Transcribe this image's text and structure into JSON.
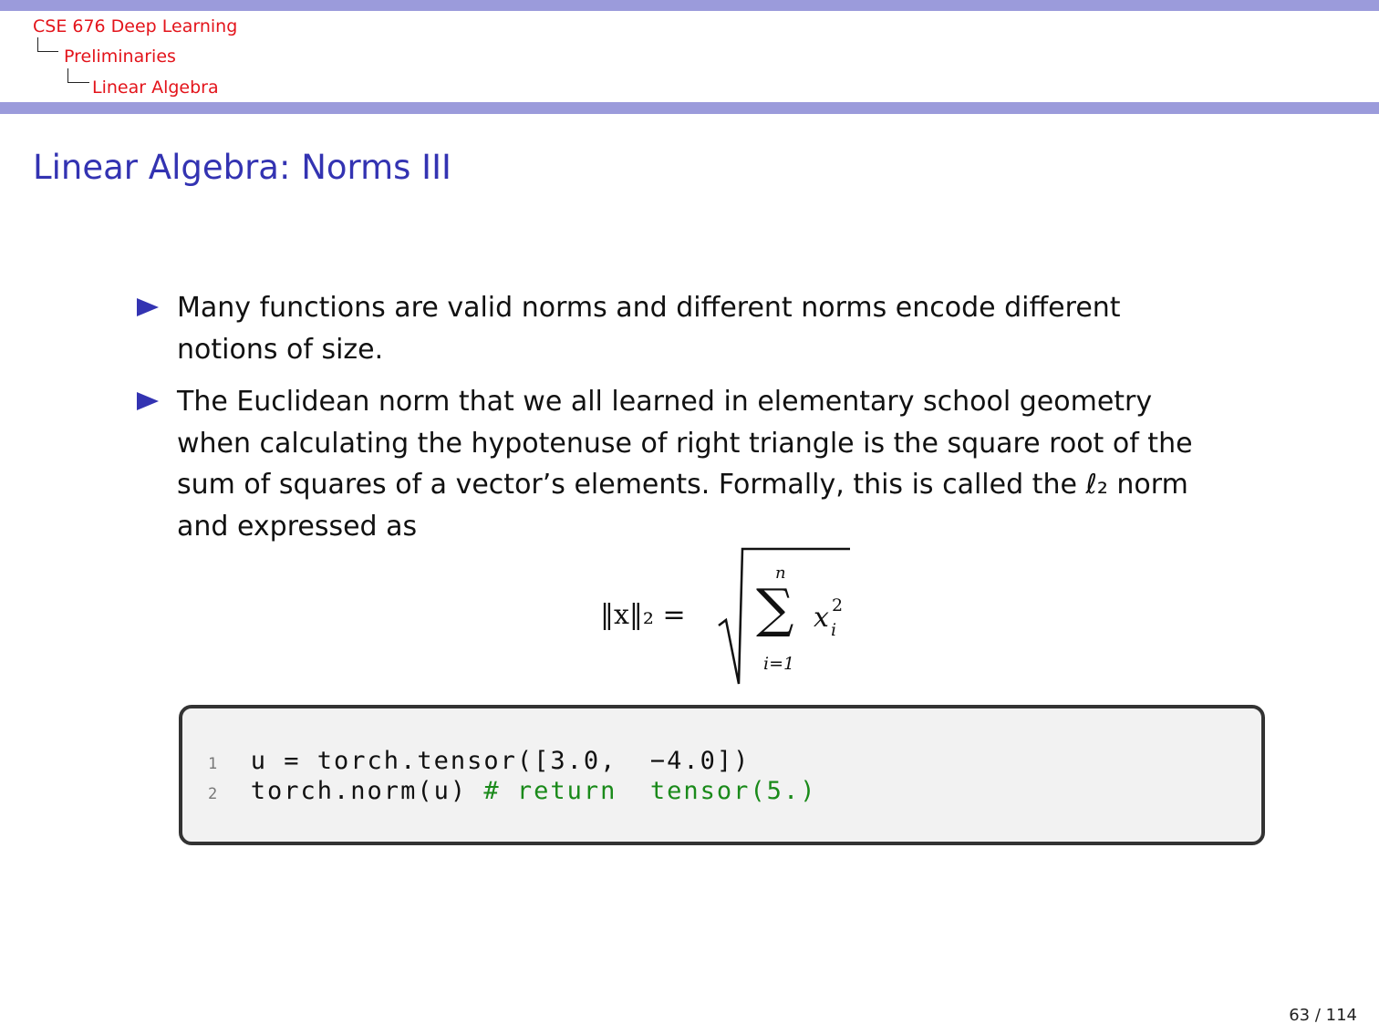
{
  "breadcrumb": {
    "course": "CSE 676 Deep Learning",
    "section": "Preliminaries",
    "subsection": "Linear Algebra"
  },
  "slide": {
    "title": "Linear Algebra: Norms III",
    "bullets": [
      {
        "lines": [
          "Many functions are valid norms and different norms encode different",
          "notions of size."
        ]
      },
      {
        "lines": [
          "The Euclidean norm that we all learned in elementary school geometry",
          "when calculating the hypotenuse of right triangle is the square root of the",
          "sum of squares of a vector’s elements.  Formally, this is called the ℓ₂ norm",
          "and expressed as"
        ]
      }
    ],
    "formula": {
      "lhs": "‖x‖₂ =",
      "sum_upper": "n",
      "sum_lower": "i=1",
      "term": "x",
      "term_sub": "i",
      "term_sup": "2"
    },
    "code": [
      {
        "num": "1",
        "code": "u = torch.tensor([3.0,  −4.0])",
        "comment": ""
      },
      {
        "num": "2",
        "code": "torch.norm(u) ",
        "comment": "# return  tensor(5.)"
      }
    ]
  },
  "footer": {
    "page": "63 / 114"
  },
  "colors": {
    "header_bar": "#9b9bdb",
    "title": "#3333b2",
    "breadcrumb": "#e3141b",
    "comment": "#1a8a1a"
  }
}
